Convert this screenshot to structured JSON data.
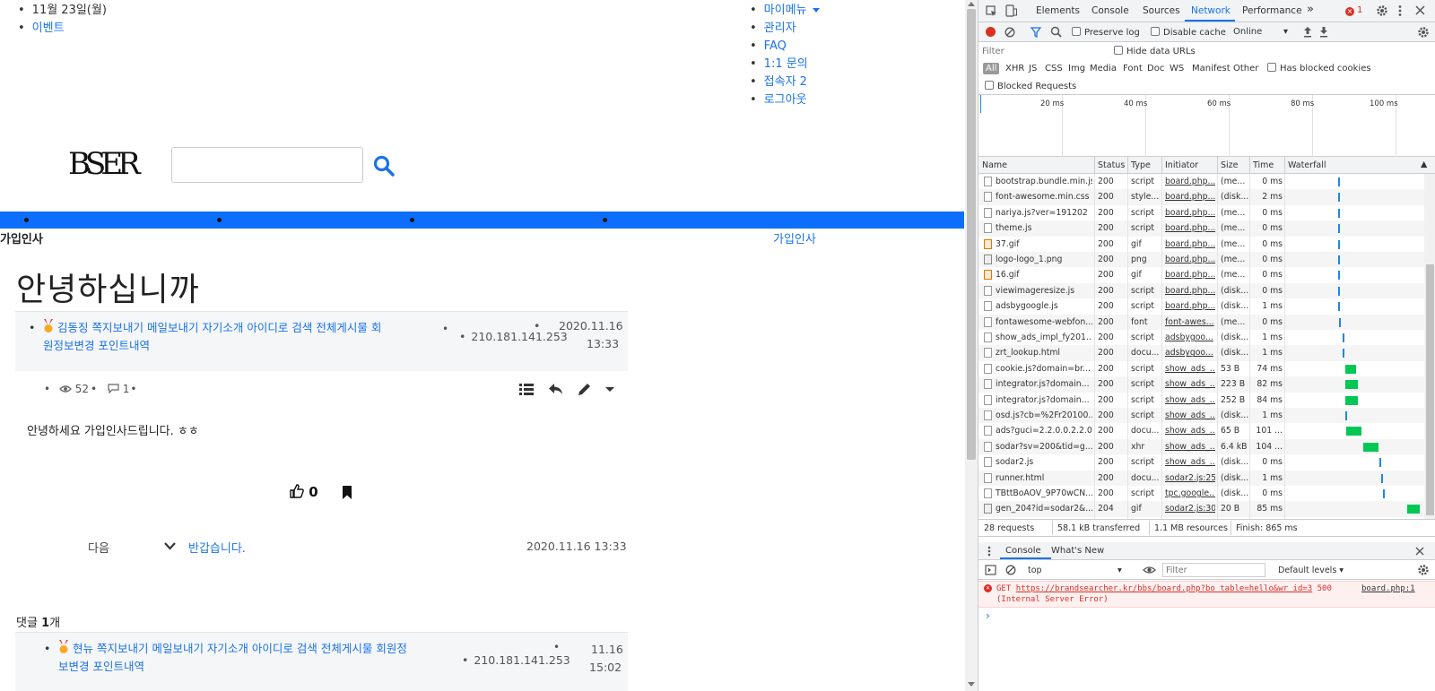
{
  "page": {
    "date_line": "11월 23일(월)",
    "event_link": "이벤트",
    "top_menu": [
      "마이메뉴",
      "관리자",
      "FAQ",
      "1:1 문의",
      "접속자 2",
      "로그아웃"
    ],
    "logo_text": "BSER",
    "breadcrumb_left": "가입인사",
    "breadcrumb_right": "가입인사",
    "post_title": "안녕하십니까",
    "author": {
      "name_line1": "김동징 쪽지보내기 메일보내기 자기소개 아이디로 검색 전체게시물 회",
      "name_line2": "원정보변경 포인트내역",
      "ip": "210.181.141.253",
      "date": "2020.11.16",
      "time": "13:33"
    },
    "stats": {
      "views": "52",
      "comments": "1"
    },
    "content": "안녕하세요 가입인사드립니다. ㅎㅎ",
    "likes": "0",
    "next": {
      "label": "다음",
      "title": "반갑습니다.",
      "datetime": "2020.11.16 13:33"
    },
    "comments_header": {
      "label": "댓글 ",
      "count": "1",
      "suffix": "개"
    },
    "comment": {
      "name_line1": "현뉴 쪽지보내기 메일보내기 자기소개 아이디로 검색 전체게시물 회원정",
      "name_line2": "보변경 포인트내역",
      "ip": "210.181.141.253",
      "date": "11.16",
      "time": "15:02"
    }
  },
  "devtools": {
    "tabs": [
      "Elements",
      "Console",
      "Sources",
      "Network",
      "Performance"
    ],
    "active_tab": "Network",
    "more_tabs": "»",
    "error_count": "1",
    "toolbar": {
      "preserve_log": "Preserve log",
      "disable_cache": "Disable cache",
      "throttle": "Online"
    },
    "filter_placeholder": "Filter",
    "hide_data_urls": "Hide data URLs",
    "type_filters": [
      "All",
      "XHR",
      "JS",
      "CSS",
      "Img",
      "Media",
      "Font",
      "Doc",
      "WS",
      "Manifest",
      "Other"
    ],
    "has_blocked_cookies": "Has blocked cookies",
    "blocked_requests": "Blocked Requests",
    "timeline_ticks": [
      "20 ms",
      "40 ms",
      "60 ms",
      "80 ms",
      "100 ms"
    ],
    "columns": [
      "Name",
      "Status",
      "Type",
      "Initiator",
      "Size",
      "Time",
      "Waterfall"
    ],
    "requests": [
      {
        "name": "bootstrap.bundle.min.js",
        "status": "200",
        "type": "script",
        "initiator": "board.php...",
        "size": "(me...",
        "time": "0 ms",
        "icon": "doc",
        "wf_start": 0.38,
        "wf_len": 0.004
      },
      {
        "name": "font-awesome.min.css",
        "status": "200",
        "type": "style...",
        "initiator": "board.php...",
        "size": "(disk...",
        "time": "2 ms",
        "icon": "doc",
        "wf_start": 0.38,
        "wf_len": 0.006
      },
      {
        "name": "nariya.js?ver=191202",
        "status": "200",
        "type": "script",
        "initiator": "board.php...",
        "size": "(me...",
        "time": "0 ms",
        "icon": "doc",
        "wf_start": 0.38,
        "wf_len": 0.004
      },
      {
        "name": "theme.js",
        "status": "200",
        "type": "script",
        "initiator": "board.php...",
        "size": "(me...",
        "time": "0 ms",
        "icon": "doc",
        "wf_start": 0.38,
        "wf_len": 0.004
      },
      {
        "name": "37.gif",
        "status": "200",
        "type": "gif",
        "initiator": "board.php...",
        "size": "(me...",
        "time": "0 ms",
        "icon": "img",
        "wf_start": 0.38,
        "wf_len": 0.004
      },
      {
        "name": "logo-logo_1.png",
        "status": "200",
        "type": "png",
        "initiator": "board.php...",
        "size": "(me...",
        "time": "0 ms",
        "icon": "png",
        "wf_start": 0.38,
        "wf_len": 0.004
      },
      {
        "name": "16.gif",
        "status": "200",
        "type": "gif",
        "initiator": "board.php...",
        "size": "(me...",
        "time": "0 ms",
        "icon": "img",
        "wf_start": 0.38,
        "wf_len": 0.004
      },
      {
        "name": "viewimageresize.js",
        "status": "200",
        "type": "script",
        "initiator": "board.php...",
        "size": "(disk...",
        "time": "0 ms",
        "icon": "doc",
        "wf_start": 0.38,
        "wf_len": 0.004
      },
      {
        "name": "adsbygoogle.js",
        "status": "200",
        "type": "script",
        "initiator": "board.php...",
        "size": "(disk...",
        "time": "1 ms",
        "icon": "doc",
        "wf_start": 0.38,
        "wf_len": 0.005
      },
      {
        "name": "fontawesome-webfon...",
        "status": "200",
        "type": "font",
        "initiator": "font-awes...",
        "size": "(me...",
        "time": "0 ms",
        "icon": "doc",
        "wf_start": 0.39,
        "wf_len": 0.004
      },
      {
        "name": "show_ads_impl_fy201...",
        "status": "200",
        "type": "script",
        "initiator": "adsbygoo...",
        "size": "(disk...",
        "time": "1 ms",
        "icon": "doc",
        "wf_start": 0.41,
        "wf_len": 0.005
      },
      {
        "name": "zrt_lookup.html",
        "status": "200",
        "type": "docu...",
        "initiator": "adsbygoo...",
        "size": "(disk...",
        "time": "1 ms",
        "icon": "doc",
        "wf_start": 0.41,
        "wf_len": 0.005
      },
      {
        "name": "cookie.js?domain=br...",
        "status": "200",
        "type": "script",
        "initiator": "show_ads_...",
        "size": "53 B",
        "time": "74 ms",
        "icon": "doc",
        "wf_start": 0.43,
        "wf_len": 0.08
      },
      {
        "name": "integrator.js?domain...",
        "status": "200",
        "type": "script",
        "initiator": "show_ads_...",
        "size": "223 B",
        "time": "82 ms",
        "icon": "doc",
        "wf_start": 0.43,
        "wf_len": 0.09
      },
      {
        "name": "integrator.js?domain...",
        "status": "200",
        "type": "script",
        "initiator": "show_ads_...",
        "size": "252 B",
        "time": "84 ms",
        "icon": "doc",
        "wf_start": 0.43,
        "wf_len": 0.09
      },
      {
        "name": "osd.js?cb=%2Fr20100...",
        "status": "200",
        "type": "script",
        "initiator": "show_ads_...",
        "size": "(disk...",
        "time": "1 ms",
        "icon": "doc",
        "wf_start": 0.43,
        "wf_len": 0.005
      },
      {
        "name": "ads?guci=2.2.0.0.2.2.0...",
        "status": "200",
        "type": "docu...",
        "initiator": "show_ads_...",
        "size": "65 B",
        "time": "101 ...",
        "icon": "doc",
        "wf_start": 0.44,
        "wf_len": 0.11
      },
      {
        "name": "sodar?sv=200&tid=g...",
        "status": "200",
        "type": "xhr",
        "initiator": "show_ads_...",
        "size": "6.4 kB",
        "time": "104 ...",
        "icon": "doc",
        "wf_start": 0.56,
        "wf_len": 0.11
      },
      {
        "name": "sodar2.js",
        "status": "200",
        "type": "script",
        "initiator": "show_ads_...",
        "size": "(disk...",
        "time": "0 ms",
        "icon": "doc",
        "wf_start": 0.68,
        "wf_len": 0.005
      },
      {
        "name": "runner.html",
        "status": "200",
        "type": "docu...",
        "initiator": "sodar2.js:25",
        "size": "(disk...",
        "time": "1 ms",
        "icon": "doc",
        "wf_start": 0.69,
        "wf_len": 0.005
      },
      {
        "name": "TBttBoAOV_9P70wCN...",
        "status": "200",
        "type": "script",
        "initiator": "tpc.google...",
        "size": "(disk...",
        "time": "0 ms",
        "icon": "doc",
        "wf_start": 0.7,
        "wf_len": 0.005
      },
      {
        "name": "gen_204?id=sodar2&...",
        "status": "204",
        "type": "gif",
        "initiator": "sodar2.js:30",
        "size": "20 B",
        "time": "85 ms",
        "icon": "png",
        "wf_start": 0.88,
        "wf_len": 0.09
      }
    ],
    "summary": [
      "28 requests",
      "58.1 kB transferred",
      "1.1 MB resources",
      "Finish: 865 ms"
    ],
    "drawer_tabs": [
      "Console",
      "What's New"
    ],
    "console_context": "top",
    "console_filter_placeholder": "Filter",
    "console_levels": "Default levels ▾",
    "console_error": {
      "method": "GET",
      "url": "https://brandsearcher.kr/bbs/board.php?bo_table=hello&wr_id=3",
      "code": "500",
      "text": "(Internal Server Error)",
      "source": "board.php:1"
    },
    "prompt": "›",
    "colors": {
      "accent": "#1a73e8",
      "waterfall_green": "#00c853",
      "waterfall_blue": "#1e88e5",
      "error": "#d93025"
    }
  }
}
